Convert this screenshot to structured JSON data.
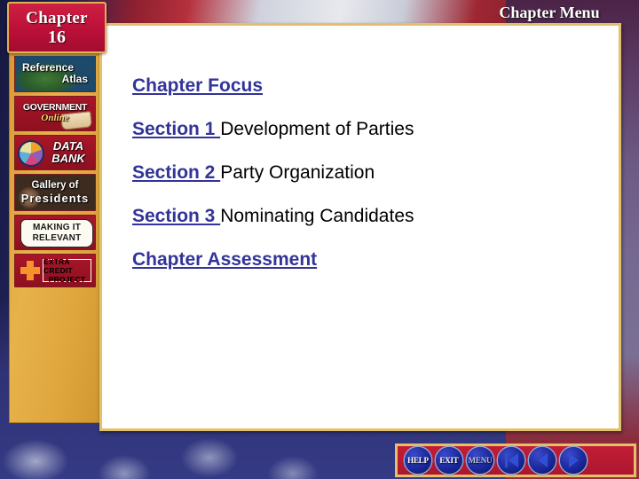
{
  "header": {
    "chapter_word": "Chapter",
    "chapter_number": "16",
    "menu_title": "Chapter Menu"
  },
  "sidebar": {
    "items": [
      {
        "id": "reference-atlas",
        "line1": "Reference",
        "line2": "Atlas",
        "icon": "map-icon"
      },
      {
        "id": "government-online",
        "line1": "GOVERNMENT",
        "line2": "Online",
        "icon": "book-icon"
      },
      {
        "id": "data-bank",
        "line1": "DATA",
        "line2": "BANK",
        "icon": "pie-chart-icon"
      },
      {
        "id": "gallery-of-presidents",
        "line1": "Gallery of",
        "line2": "Presidents",
        "icon": "portraits-icon"
      },
      {
        "id": "making-it-relevant",
        "line1": "MAKING IT",
        "line2": "RELEVANT",
        "icon": "speech-bubble-icon"
      },
      {
        "id": "extra-credit-project",
        "line1": "EXTRA CREDIT",
        "line2": "PROJECT",
        "icon": "plus-cross-icon"
      }
    ]
  },
  "main": {
    "menu_items": [
      {
        "link": "Chapter Focus",
        "text": ""
      },
      {
        "link": "Section 1 ",
        "text": "Development of Parties"
      },
      {
        "link": "Section 2 ",
        "text": "Party Organization"
      },
      {
        "link": "Section 3 ",
        "text": "Nominating Candidates"
      },
      {
        "link": "Chapter Assessment",
        "text": ""
      }
    ]
  },
  "navbar": {
    "buttons": [
      {
        "id": "help",
        "label": "HELP",
        "type": "text"
      },
      {
        "id": "exit",
        "label": "EXIT",
        "type": "text"
      },
      {
        "id": "menu",
        "label": "MENU",
        "type": "text"
      },
      {
        "id": "first",
        "label": "",
        "type": "back-to-start"
      },
      {
        "id": "previous",
        "label": "",
        "type": "arrow-left"
      },
      {
        "id": "next",
        "label": "",
        "type": "arrow-right"
      }
    ]
  },
  "colors": {
    "link": "#333399",
    "panel_border": "#e3c06a",
    "sidebar": "#e0a63e",
    "button_red": "#a81628",
    "nav_red": "#c21d36",
    "nav_button": "#1c2a9e"
  }
}
